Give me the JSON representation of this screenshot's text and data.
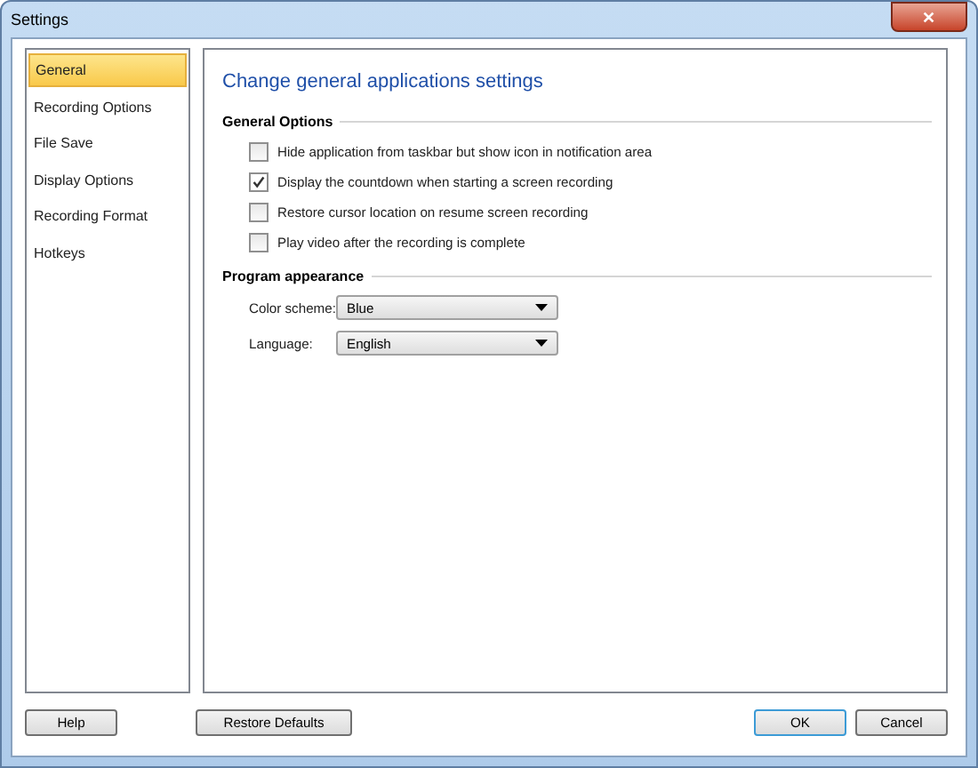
{
  "window": {
    "title": "Settings",
    "close": "✕"
  },
  "sidebar": {
    "items": [
      {
        "label": "General",
        "selected": true
      },
      {
        "label": "Recording Options",
        "selected": false
      },
      {
        "label": "File Save",
        "selected": false
      },
      {
        "label": "Display Options",
        "selected": false
      },
      {
        "label": "Recording Format",
        "selected": false
      },
      {
        "label": "Hotkeys",
        "selected": false
      }
    ]
  },
  "panel": {
    "heading": "Change general applications settings",
    "general_options": {
      "title": "General Options",
      "options": [
        {
          "label": "Hide application from taskbar but show icon in notification area",
          "checked": false
        },
        {
          "label": "Display the countdown when starting a screen recording",
          "checked": true
        },
        {
          "label": "Restore cursor location on resume screen recording",
          "checked": false
        },
        {
          "label": "Play video after the recording is complete",
          "checked": false
        }
      ]
    },
    "program_appearance": {
      "title": "Program appearance",
      "fields": [
        {
          "label": "Color scheme:",
          "value": "Blue"
        },
        {
          "label": "Language:",
          "value": "English"
        }
      ]
    }
  },
  "buttons": {
    "help": "Help",
    "restore": "Restore Defaults",
    "ok": "OK",
    "cancel": "Cancel"
  }
}
